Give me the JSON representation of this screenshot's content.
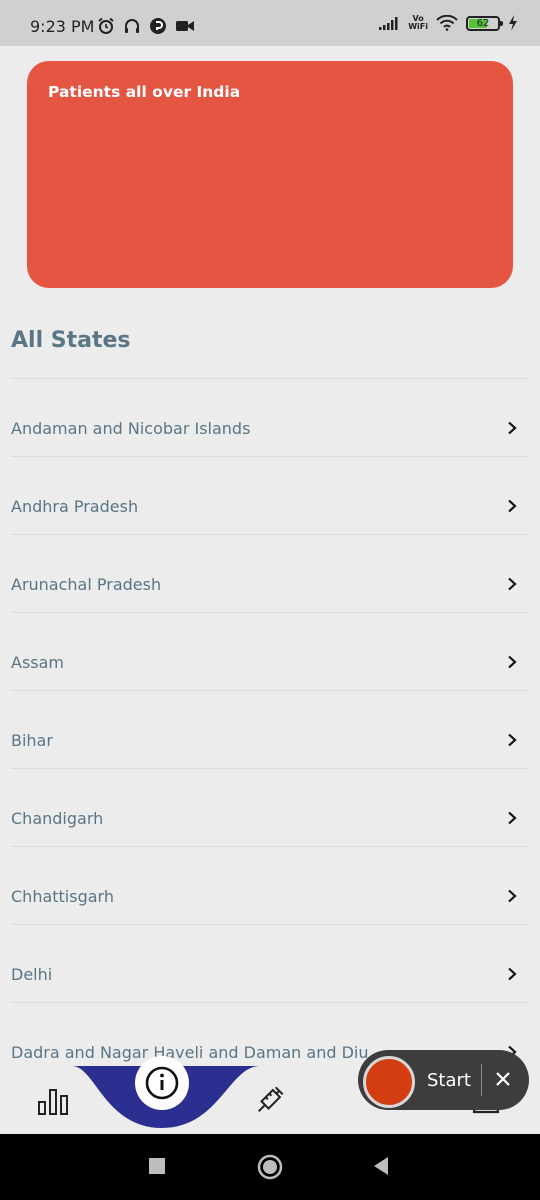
{
  "status_bar": {
    "time": "9:23 PM",
    "left_icons": [
      "alarm-icon",
      "headphones-icon",
      "app-icon",
      "video-icon"
    ],
    "right_icons": [
      "signal-icon",
      "vowifi-icon",
      "wifi-icon",
      "battery-icon",
      "charging-icon"
    ],
    "vowifi_top": "Vo",
    "vowifi_bottom": "WiFi",
    "battery_level": "62"
  },
  "hero": {
    "title": "Patients all over India",
    "color": "#e55642"
  },
  "section": {
    "title": "All States"
  },
  "states": [
    "Andaman and Nicobar Islands",
    "Andhra Pradesh",
    "Arunachal Pradesh",
    "Assam",
    "Bihar",
    "Chandigarh",
    "Chhattisgarh",
    "Delhi",
    "Dadra and Nagar Haveli and Daman and Diu"
  ],
  "bottom_nav": {
    "items": [
      "bar-chart-icon",
      "info-icon",
      "vaccine-icon",
      "profile-icon"
    ],
    "active": "info-icon",
    "accent": "#2b2f8f"
  },
  "recorder": {
    "start_label": "Start"
  },
  "android_nav": [
    "square-icon",
    "circle-icon",
    "back-icon"
  ]
}
